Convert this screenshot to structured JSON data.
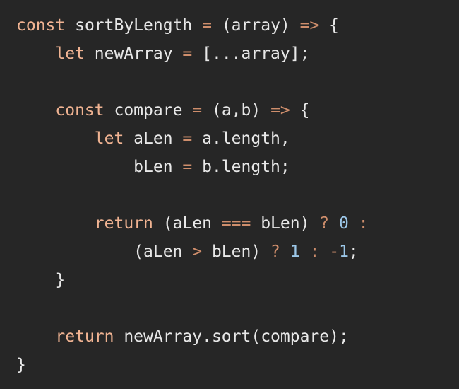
{
  "theme": {
    "background": "#262626",
    "text": "#e8e8e8",
    "keyword": "#f0b392",
    "operator": "#cf8e6c",
    "number": "#9cc7e8"
  },
  "code": {
    "lines": [
      {
        "tokens": [
          {
            "t": "const",
            "type": "kw"
          },
          {
            "t": " sortByLength ",
            "type": "tx"
          },
          {
            "t": "=",
            "type": "op"
          },
          {
            "t": " (array) ",
            "type": "tx"
          },
          {
            "t": "=>",
            "type": "op"
          },
          {
            "t": " {",
            "type": "tx"
          }
        ]
      },
      {
        "tokens": [
          {
            "t": "    ",
            "type": "tx"
          },
          {
            "t": "let",
            "type": "kw"
          },
          {
            "t": " newArray ",
            "type": "tx"
          },
          {
            "t": "=",
            "type": "op"
          },
          {
            "t": " [...array];",
            "type": "tx"
          }
        ]
      },
      {
        "tokens": []
      },
      {
        "tokens": [
          {
            "t": "    ",
            "type": "tx"
          },
          {
            "t": "const",
            "type": "kw"
          },
          {
            "t": " compare ",
            "type": "tx"
          },
          {
            "t": "=",
            "type": "op"
          },
          {
            "t": " (a,b) ",
            "type": "tx"
          },
          {
            "t": "=>",
            "type": "op"
          },
          {
            "t": " {",
            "type": "tx"
          }
        ]
      },
      {
        "tokens": [
          {
            "t": "        ",
            "type": "tx"
          },
          {
            "t": "let",
            "type": "kw"
          },
          {
            "t": " aLen ",
            "type": "tx"
          },
          {
            "t": "=",
            "type": "op"
          },
          {
            "t": " a.length,",
            "type": "tx"
          }
        ]
      },
      {
        "tokens": [
          {
            "t": "            bLen ",
            "type": "tx"
          },
          {
            "t": "=",
            "type": "op"
          },
          {
            "t": " b.length;",
            "type": "tx"
          }
        ]
      },
      {
        "tokens": []
      },
      {
        "tokens": [
          {
            "t": "        ",
            "type": "tx"
          },
          {
            "t": "return",
            "type": "kw"
          },
          {
            "t": " (aLen ",
            "type": "tx"
          },
          {
            "t": "===",
            "type": "op"
          },
          {
            "t": " bLen) ",
            "type": "tx"
          },
          {
            "t": "?",
            "type": "op"
          },
          {
            "t": " ",
            "type": "tx"
          },
          {
            "t": "0",
            "type": "num"
          },
          {
            "t": " ",
            "type": "tx"
          },
          {
            "t": ":",
            "type": "op"
          }
        ]
      },
      {
        "tokens": [
          {
            "t": "            (aLen ",
            "type": "tx"
          },
          {
            "t": ">",
            "type": "op"
          },
          {
            "t": " bLen) ",
            "type": "tx"
          },
          {
            "t": "?",
            "type": "op"
          },
          {
            "t": " ",
            "type": "tx"
          },
          {
            "t": "1",
            "type": "num"
          },
          {
            "t": " ",
            "type": "tx"
          },
          {
            "t": ":",
            "type": "op"
          },
          {
            "t": " ",
            "type": "tx"
          },
          {
            "t": "-",
            "type": "op"
          },
          {
            "t": "1",
            "type": "num"
          },
          {
            "t": ";",
            "type": "tx"
          }
        ]
      },
      {
        "tokens": [
          {
            "t": "    }",
            "type": "tx"
          }
        ]
      },
      {
        "tokens": []
      },
      {
        "tokens": [
          {
            "t": "    ",
            "type": "tx"
          },
          {
            "t": "return",
            "type": "kw"
          },
          {
            "t": " newArray.sort(compare);",
            "type": "tx"
          }
        ]
      },
      {
        "tokens": [
          {
            "t": "}",
            "type": "tx"
          }
        ]
      }
    ]
  }
}
